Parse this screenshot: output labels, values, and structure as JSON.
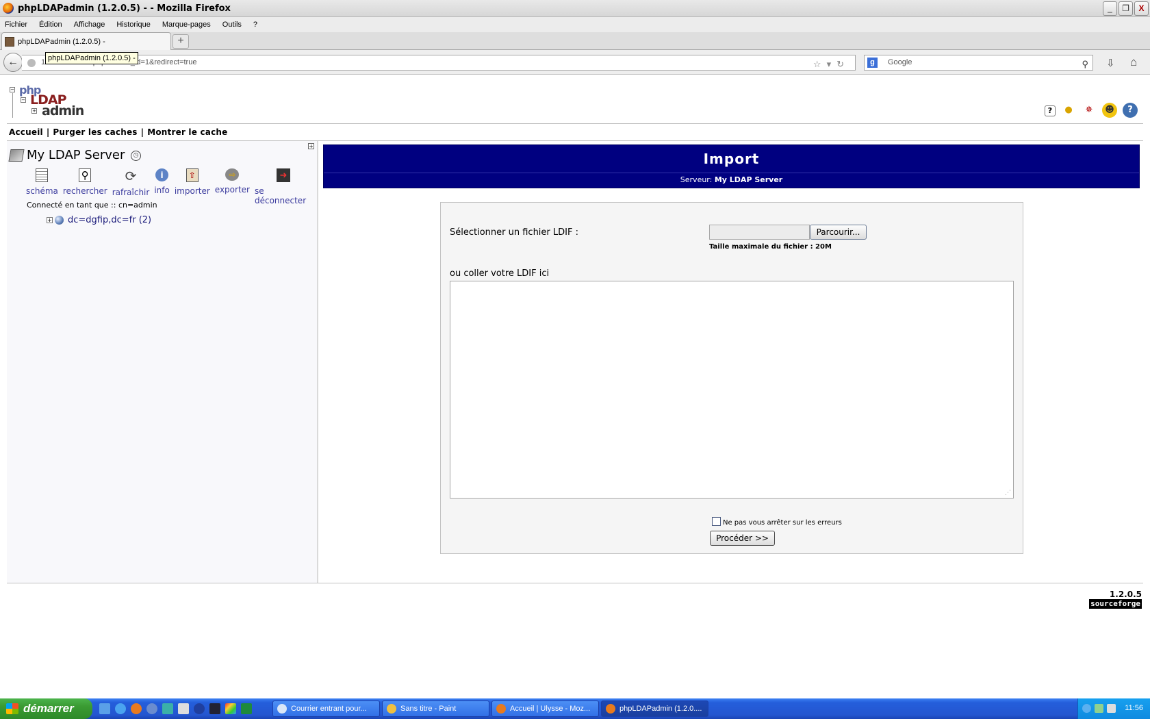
{
  "window": {
    "title": "phpLDAPadmin (1.2.0.5) - - Mozilla Firefox",
    "controls": [
      "_",
      "❐",
      "X"
    ]
  },
  "menubar": [
    "Fichier",
    "Édition",
    "Affichage",
    "Historique",
    "Marque-pages",
    "Outils",
    "?"
  ],
  "tab": {
    "label": "phpLDAPadmin (1.2.0.5) -",
    "tooltip": "phpLDAPadmin (1.2.0.5) -"
  },
  "navbar": {
    "url": "1               cmd.php?server_id=1&redirect=true",
    "search_placeholder": "Google"
  },
  "logo": {
    "php": "php",
    "ldap": "LDAP",
    "admin": "admin"
  },
  "toplinks": {
    "home": "Accueil",
    "purge": "Purger les caches",
    "show_cache": "Montrer le cache"
  },
  "left": {
    "server_name": "My LDAP Server",
    "actions": [
      {
        "label": "schéma",
        "icon": "schema-icon"
      },
      {
        "label": "rechercher",
        "icon": "search-icon"
      },
      {
        "label": "rafraîchir",
        "icon": "refresh-icon"
      },
      {
        "label": "info",
        "icon": "info-icon"
      },
      {
        "label": "importer",
        "icon": "import-icon"
      },
      {
        "label": "exporter",
        "icon": "export-icon"
      },
      {
        "label": "se déconnecter",
        "icon": "logout-icon"
      }
    ],
    "connected": "Connecté en tant que :: cn=admin",
    "tree_dn": "dc=dgfip,dc=fr (2)"
  },
  "main": {
    "title": "Import",
    "server_label": "Serveur:",
    "server_value": "My LDAP Server",
    "select_label": "Sélectionner un fichier LDIF :",
    "browse_label": "Parcourir...",
    "max_size": "Taille maximale du fichier : 20M",
    "paste_label": "ou coller votre LDIF ici",
    "ldif_text": "",
    "continue_label": "Ne pas vous arrêter sur les erreurs",
    "continue_checked": false,
    "proceed_label": "Procéder >>"
  },
  "footer": {
    "version": "1.2.0.5",
    "sourceforge": "sourceforge"
  },
  "taskbar": {
    "start_label": "démarrer",
    "tasks": [
      "Courrier entrant pour...",
      "Sans titre - Paint",
      "Accueil | Ulysse - Moz...",
      "phpLDAPadmin (1.2.0...."
    ],
    "clock": "11:56"
  },
  "colors": {
    "header_bg": "#000080",
    "link": "#3b3b9e",
    "taskbar": "#245edb"
  }
}
